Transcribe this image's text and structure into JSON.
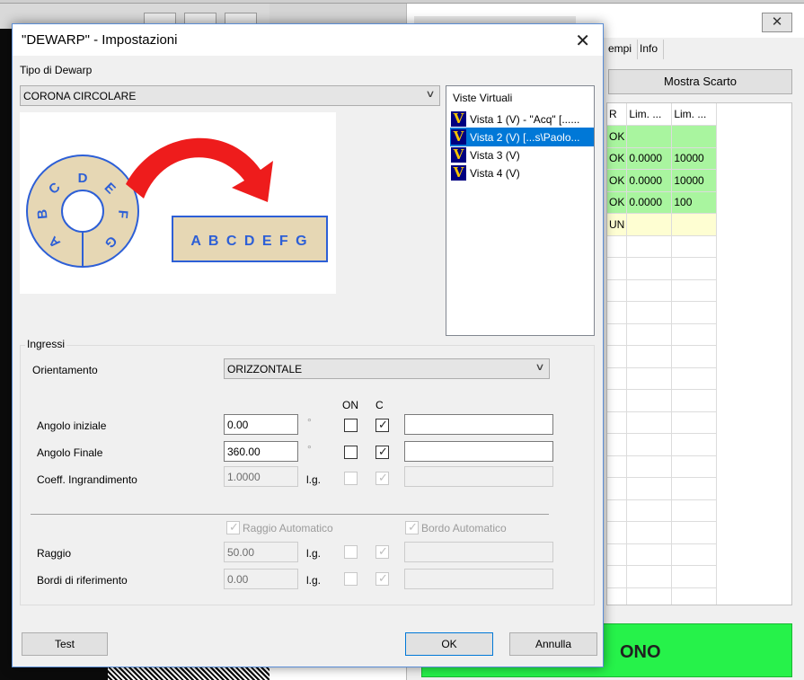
{
  "background": {
    "right_window": {
      "tabs": [
        "empi",
        "Info"
      ],
      "button": "Mostra Scarto",
      "close_glyph": "✕",
      "headers": [
        "R",
        "Lim. ...",
        "Lim. ..."
      ],
      "rows": [
        {
          "status": "OK",
          "a": "",
          "b": "",
          "color": "green"
        },
        {
          "status": "OK",
          "a": "0.0000",
          "b": "10000",
          "color": "green"
        },
        {
          "status": "OK",
          "a": "0.0000",
          "b": "10000",
          "color": "green"
        },
        {
          "status": "OK",
          "a": "0.0000",
          "b": "100",
          "color": "green"
        },
        {
          "status": "UN",
          "a": "",
          "b": "",
          "color": "yellow"
        }
      ],
      "status_text": "ONO",
      "status_color": "#26f24a"
    }
  },
  "dialog": {
    "title": "\"DEWARP\" - Impostazioni",
    "close_glyph": "✕",
    "tipo_label": "Tipo di Dewarp",
    "tipo_value": "CORONA CIRCOLARE",
    "illustration": {
      "ring_letters": [
        "A",
        "B",
        "C",
        "D",
        "E",
        "F",
        "G"
      ],
      "strip_text": "A B C D E F G",
      "arrow_color": "#ee1c1c",
      "ring_fill": "#e6d7b4",
      "line_color": "#2d5fd6"
    },
    "viste": {
      "header": "Viste Virtuali",
      "icon_letter": "V",
      "items": [
        {
          "label": "Vista 1 (V) - \"Acq\" [......",
          "selected": false
        },
        {
          "label": "Vista 2 (V) [...s\\Paolo...",
          "selected": true
        },
        {
          "label": "Vista 3 (V)",
          "selected": false
        },
        {
          "label": "Vista 4 (V)",
          "selected": false
        }
      ]
    },
    "ingressi": {
      "title": "Ingressi",
      "orientamento_label": "Orientamento",
      "orientamento_value": "ORIZZONTALE",
      "on_header": "ON",
      "c_header": "C",
      "degree": "°",
      "lg": "l.g.",
      "angolo_iniziale": {
        "label": "Angolo iniziale",
        "value": "0.00",
        "on": false,
        "c": true,
        "extra": ""
      },
      "angolo_finale": {
        "label": "Angolo Finale",
        "value": "360.00",
        "on": false,
        "c": true,
        "extra": ""
      },
      "coeff": {
        "label": "Coeff. Ingrandimento",
        "value": "1.0000",
        "on": false,
        "c": true
      },
      "raggio_auto": {
        "label": "Raggio Automatico",
        "checked": true
      },
      "bordo_auto": {
        "label": "Bordo Automatico",
        "checked": true
      },
      "raggio": {
        "label": "Raggio",
        "value": "50.00",
        "on": false,
        "c": true
      },
      "bordi": {
        "label": "Bordi di riferimento",
        "value": "0.00",
        "on": false,
        "c": true
      }
    },
    "buttons": {
      "test": "Test",
      "ok": "OK",
      "cancel": "Annulla"
    }
  }
}
